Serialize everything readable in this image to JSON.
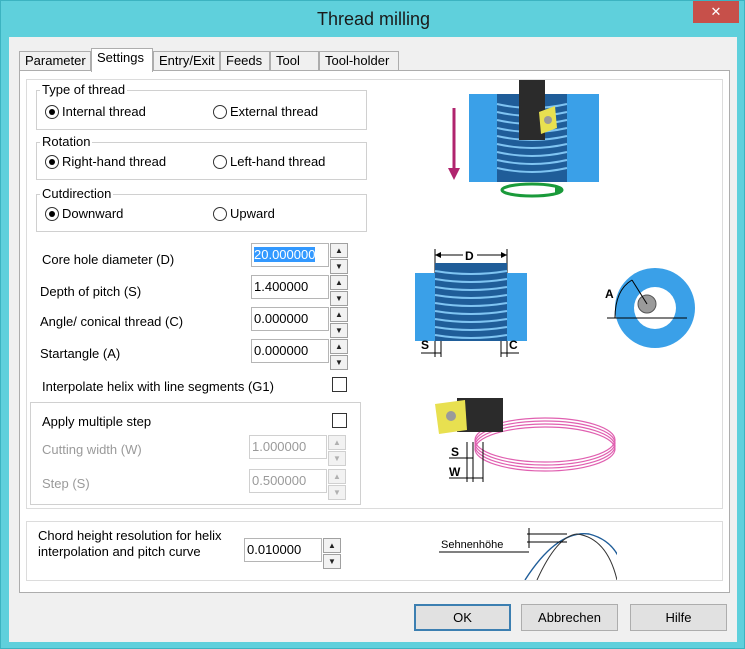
{
  "window": {
    "title": "Thread milling",
    "close_glyph": "✕"
  },
  "tabs": [
    "Parameter",
    "Settings",
    "Entry/Exit",
    "Feeds",
    "Tool",
    "Tool-holder"
  ],
  "active_tab": "Settings",
  "thread_type": {
    "label": "Type of thread",
    "options": [
      "Internal thread",
      "External thread"
    ],
    "selected": "Internal thread"
  },
  "rotation": {
    "label": "Rotation",
    "options": [
      "Right-hand thread",
      "Left-hand thread"
    ],
    "selected": "Right-hand thread"
  },
  "cutdirection": {
    "label": "Cutdirection",
    "options": [
      "Downward",
      "Upward"
    ],
    "selected": "Downward"
  },
  "params": {
    "core_hole": {
      "label": "Core hole diameter (D)",
      "value": "20.000000"
    },
    "depth_pitch": {
      "label": "Depth of pitch (S)",
      "value": "1.400000"
    },
    "angle": {
      "label": "Angle/ conical thread (C)",
      "value": "0.000000"
    },
    "startangle": {
      "label": "Startangle (A)",
      "value": "0.000000"
    }
  },
  "interpolate": {
    "label": "Interpolate helix with line segments (G1)",
    "checked": false
  },
  "multiple_step": {
    "label": "Apply multiple step",
    "checked": false,
    "cutting_width": {
      "label": "Cutting width (W)",
      "value": "1.000000"
    },
    "step": {
      "label": "Step (S)",
      "value": "0.500000"
    }
  },
  "chord": {
    "label_line1": "Chord height resolution for helix",
    "label_line2": "interpolation and pitch curve",
    "value": "0.010000",
    "diagram_label": "Sehnenhöhe"
  },
  "diagram_labels": {
    "D": "D",
    "S": "S",
    "C": "C",
    "A": "A",
    "W": "W"
  },
  "buttons": {
    "ok": "OK",
    "cancel": "Abbrechen",
    "help": "Hilfe"
  },
  "colors": {
    "titlebar": "#5fd0dc",
    "close": "#c7504a",
    "part_blue": "#3aa0e8",
    "dark_blue": "#1f5d99",
    "helix_pink": "#e060b0",
    "arrow_green": "#1a9a3a",
    "arrow_magenta": "#b0246e"
  }
}
